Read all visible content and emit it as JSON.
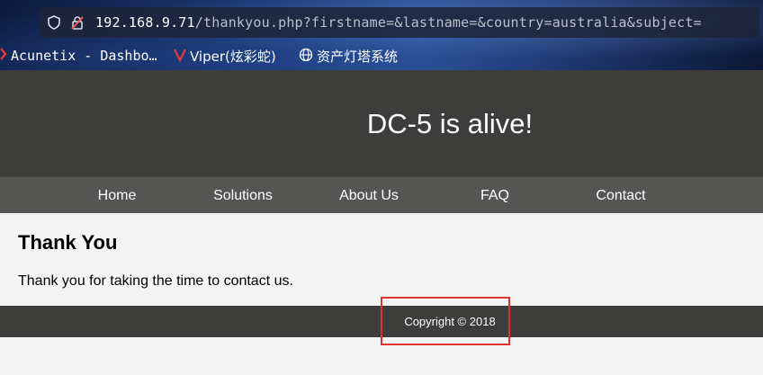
{
  "browser": {
    "url_host": "192.168.9.71",
    "url_path": "/thankyou.php?firstname=&lastname=&country=australia&subject=",
    "bookmarks": [
      {
        "label": "Acunetix - Dashbo…",
        "icon": "acunetix-icon"
      },
      {
        "label": "Viper(炫彩蛇)",
        "icon": "viper-icon"
      },
      {
        "label": "资产灯塔系统",
        "icon": "globe-icon"
      }
    ]
  },
  "site": {
    "title": "DC-5 is alive!"
  },
  "nav": {
    "items": [
      {
        "label": "Home"
      },
      {
        "label": "Solutions"
      },
      {
        "label": "About Us"
      },
      {
        "label": "FAQ"
      },
      {
        "label": "Contact"
      }
    ]
  },
  "content": {
    "heading": "Thank You",
    "message": "Thank you for taking the time to contact us."
  },
  "footer": {
    "copyright": "Copyright © 2018"
  },
  "colors": {
    "header_bg": "#3d3d3b",
    "nav_bg": "#555553",
    "highlight": "#e03030"
  }
}
